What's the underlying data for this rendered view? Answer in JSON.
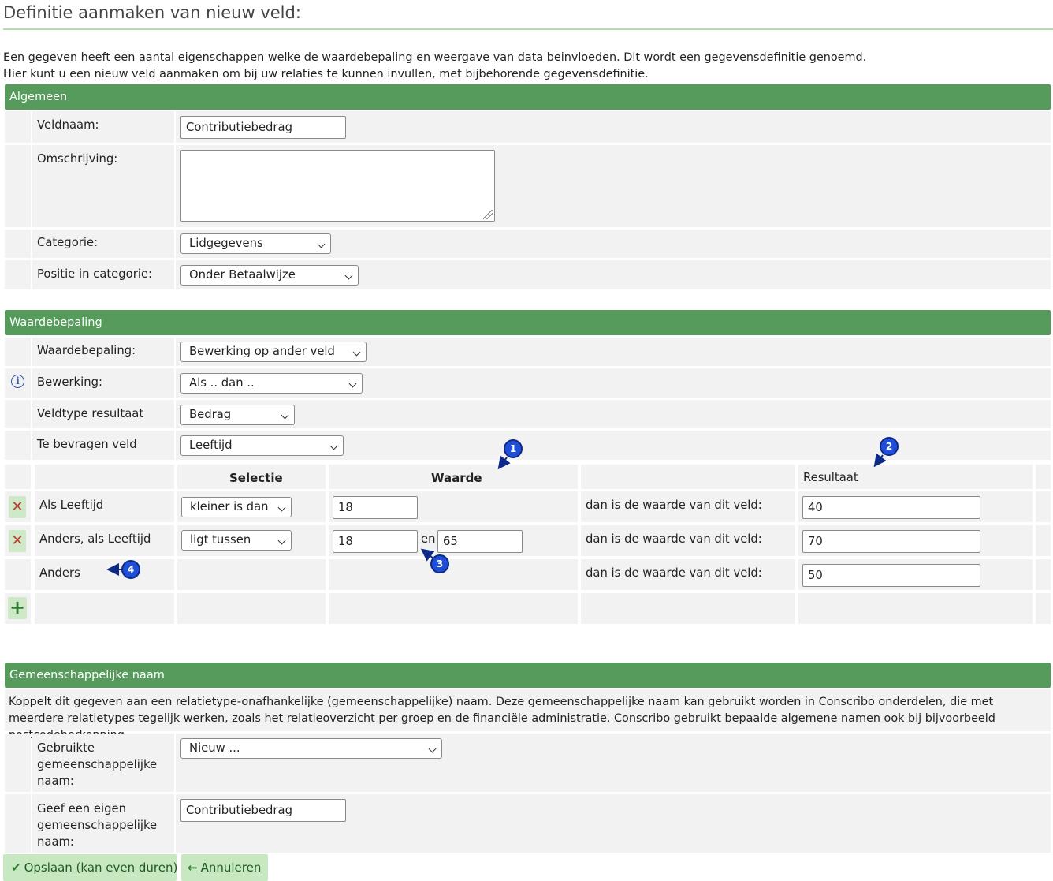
{
  "page": {
    "title": "Definitie aanmaken van nieuw veld:",
    "intro_line1": "Een gegeven heeft een aantal eigenschappen welke de waardebepaling en weergave van data beinvloeden. Dit wordt een gegevensdefinitie genoemd.",
    "intro_line2": "Hier kunt u een nieuw veld aanmaken om bij uw relaties te kunnen invullen, met bijbehorende gegevensdefinitie."
  },
  "algemeen": {
    "header": "Algemeen",
    "veldnaam_label": "Veldnaam:",
    "veldnaam_value": "Contributiebedrag",
    "omschrijving_label": "Omschrijving:",
    "omschrijving_value": "",
    "categorie_label": "Categorie:",
    "categorie_value": "Lidgegevens",
    "positie_label": "Positie in categorie:",
    "positie_value": "Onder Betaalwijze"
  },
  "waardebepaling": {
    "header": "Waardebepaling",
    "waardebepaling_label": "Waardebepaling:",
    "waardebepaling_value": "Bewerking op ander veld",
    "bewerking_label": "Bewerking:",
    "bewerking_value": "Als .. dan ..",
    "veldtype_label": "Veldtype resultaat",
    "veldtype_value": "Bedrag",
    "bevragen_label": "Te bevragen veld",
    "bevragen_value": "Leeftijd",
    "col_selectie": "Selectie",
    "col_waarde": "Waarde",
    "col_resultaat": "Resultaat",
    "rows": [
      {
        "label": "Als Leeftijd",
        "selectie": "kleiner is dan",
        "waarde1": "18",
        "dan": "dan is de waarde van dit veld:",
        "resultaat": "40"
      },
      {
        "label": "Anders, als Leeftijd",
        "selectie": "ligt tussen",
        "waarde1": "18",
        "en": "en",
        "waarde2": "65",
        "dan": "dan is de waarde van dit veld:",
        "resultaat": "70"
      },
      {
        "label": "Anders",
        "dan": "dan is de waarde van dit veld:",
        "resultaat": "50"
      }
    ],
    "badges": [
      "1",
      "2",
      "3",
      "4"
    ]
  },
  "gemeenschappelijk": {
    "header": "Gemeenschappelijke naam",
    "description": "Koppelt dit gegeven aan een relatietype-onafhankelijke (gemeenschappelijke) naam. Deze gemeenschappelijke naam kan gebruikt worden in Conscribo onderdelen, die met meerdere relatietypes tegelijk werken, zoals het relatieoverzicht per groep en de financiële administratie. Conscribo gebruikt bepaalde algemene namen ook bij bijvoorbeeld postcodeherkenning.",
    "gebruikte_label_1": "Gebruikte",
    "gebruikte_label_2": "gemeenschappelijke",
    "gebruikte_label_3": "naam:",
    "gebruikte_value": "Nieuw ...",
    "eigen_label_1": "Geef een eigen",
    "eigen_label_2": "gemeenschappelijke",
    "eigen_label_3": "naam:",
    "eigen_value": "Contributiebedrag"
  },
  "buttons": {
    "save": "Opslaan (kan even duren)",
    "cancel": "Annuleren"
  },
  "icons": {
    "check": "check-icon",
    "arrow_left": "arrow-left-icon",
    "delete": "delete-icon",
    "add": "plus-icon",
    "info": "info-icon"
  },
  "colors": {
    "section_header": "#569a5c",
    "row_bg": "#f2f2f2",
    "button_bg": "#c8e8c2",
    "badge": "#1f4fd8"
  }
}
